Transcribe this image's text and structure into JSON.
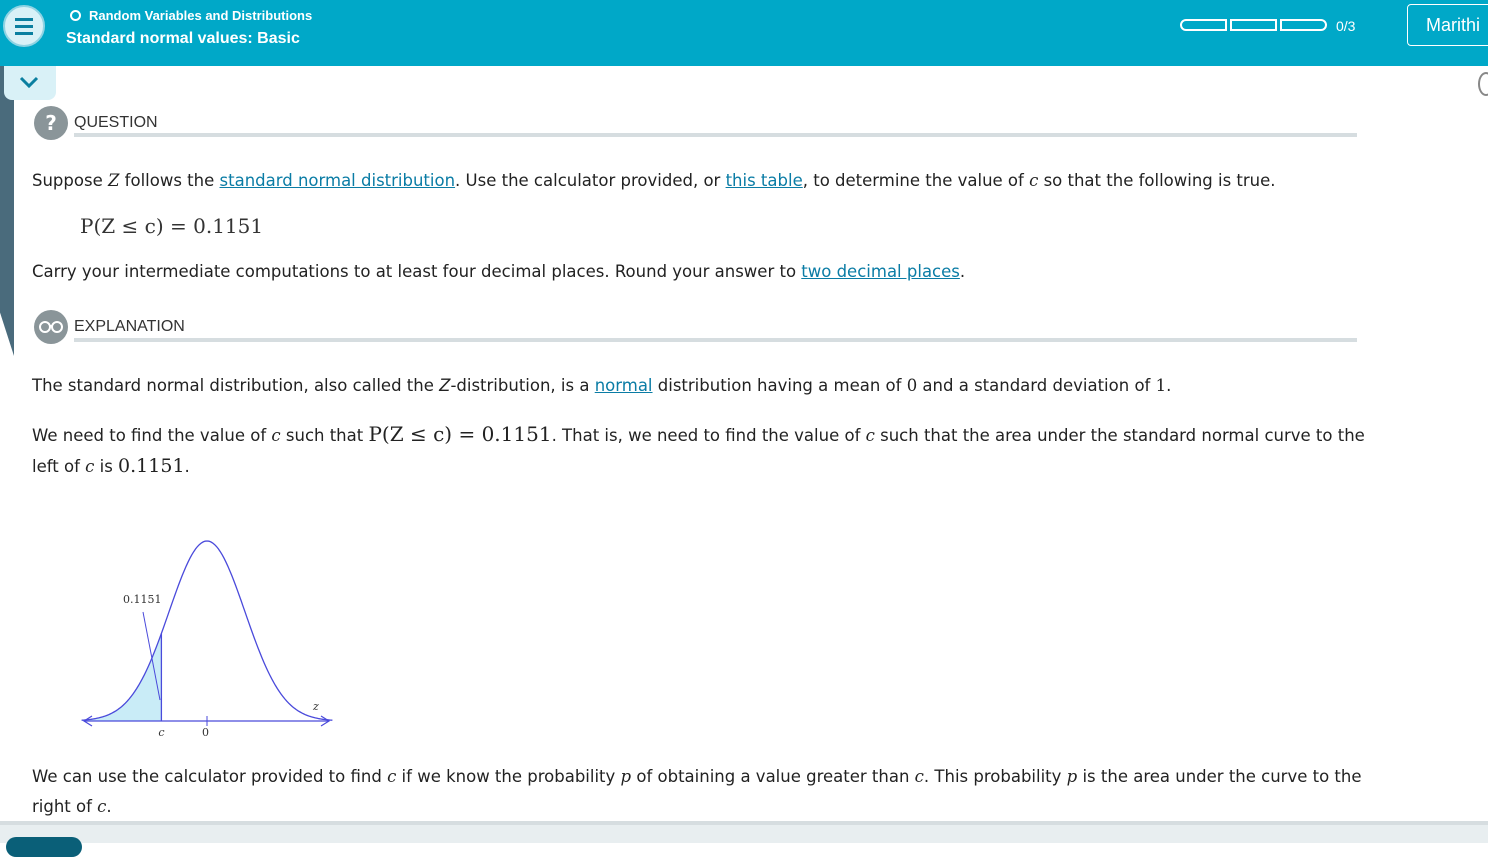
{
  "header": {
    "topic": "Random Variables and Distributions",
    "subtitle": "Standard normal values: Basic",
    "progress": {
      "label": "0/3",
      "completed": 0,
      "total": 3
    },
    "user_name": "Marithi"
  },
  "question": {
    "heading": "QUESTION",
    "line1_a": "Suppose ",
    "line1_Z": "Z",
    "line1_b": " follows the ",
    "link_std_normal": "standard normal distribution",
    "line1_c": ". Use the calculator provided, or ",
    "link_table": "this table",
    "line1_d": ", to determine the value of ",
    "line1_c_var": "c",
    "line1_e": " so that the following is true.",
    "formula": "P(Z ≤ c) = 0.1151",
    "line2_a": "Carry your intermediate computations to at least four decimal places. Round your answer to ",
    "link_two_decimal": "two decimal places",
    "line2_b": "."
  },
  "explanation": {
    "heading": "EXPLANATION",
    "p1_a": "The standard normal distribution, also called the ",
    "p1_Z": "Z",
    "p1_b": "-distribution, is a ",
    "link_normal": "normal",
    "p1_c": " distribution having a mean of ",
    "p1_mean": "0",
    "p1_d": " and a standard deviation of ",
    "p1_sd": "1",
    "p1_e": ".",
    "p2_a": "We need to find the value of ",
    "p2_c": "c",
    "p2_b": " such that ",
    "p2_formula": "P(Z ≤ c) = 0.1151",
    "p2_d": ". That is, we need to find the value of ",
    "p2_c2": "c",
    "p2_e": " such that the area under the standard normal curve to the",
    "p2_f": "left of ",
    "p2_c3": "c",
    "p2_g": " is ",
    "p2_val": "0.1151",
    "p2_h": ".",
    "p3_a": "We can use the calculator provided to find ",
    "p3_c": "c",
    "p3_b": " if we know the probability ",
    "p3_p": "p",
    "p3_d": " of obtaining a value greater than ",
    "p3_c2": "c",
    "p3_e": ". This probability ",
    "p3_p2": "p",
    "p3_f": " is the area under the curve to the",
    "p3_g": "right of ",
    "p3_c3": "c",
    "p3_h": "."
  },
  "chart_data": {
    "type": "area",
    "distribution": "standard normal",
    "shaded_region": "left tail, Z ≤ c",
    "annotation": "0.1151",
    "x_tick_labels": [
      "c",
      "0"
    ],
    "axis_label": "z",
    "c_value": -1.2,
    "shade_color": "#c9ecf7",
    "curve_color": "#4a4adb"
  },
  "colors": {
    "header_bg": "#00a8c8",
    "link": "#0a7ca5",
    "rule": "#d6dde0"
  },
  "icons": [
    "menu-icon",
    "chevron-down-icon",
    "question-icon",
    "glasses-icon"
  ]
}
